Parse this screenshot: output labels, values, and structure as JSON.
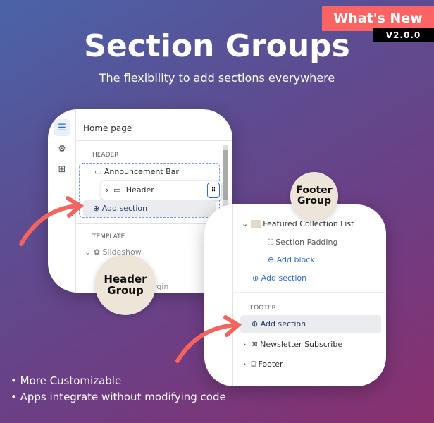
{
  "badge": {
    "label": "What's New",
    "version": "V2.0.0"
  },
  "hero": {
    "title": "Section Groups",
    "subtitle": "The flexibility to add sections everywhere"
  },
  "left_panel": {
    "page": "Home page",
    "header_label": "HEADER",
    "items": [
      "Announcement Bar",
      "Header"
    ],
    "add_section": "Add section",
    "template_label": "TEMPLATE",
    "template_item": "Slideshow",
    "partial": "rgin"
  },
  "right_panel": {
    "items": [
      "Featured Collection List",
      "Section Padding"
    ],
    "add_block": "Add block",
    "add_section": "Add section",
    "footer_label": "FOOTER",
    "footer_add": "Add section",
    "footer_items": [
      "Newsletter Subscribe",
      "Footer"
    ]
  },
  "callouts": {
    "header": [
      "Header",
      "Group"
    ],
    "footer": [
      "Footer",
      "Group"
    ]
  },
  "bullets": [
    "More Customizable",
    "Apps integrate without modifying code"
  ],
  "colors": {
    "accent": "#fb6463",
    "link": "#2c6ecb"
  }
}
